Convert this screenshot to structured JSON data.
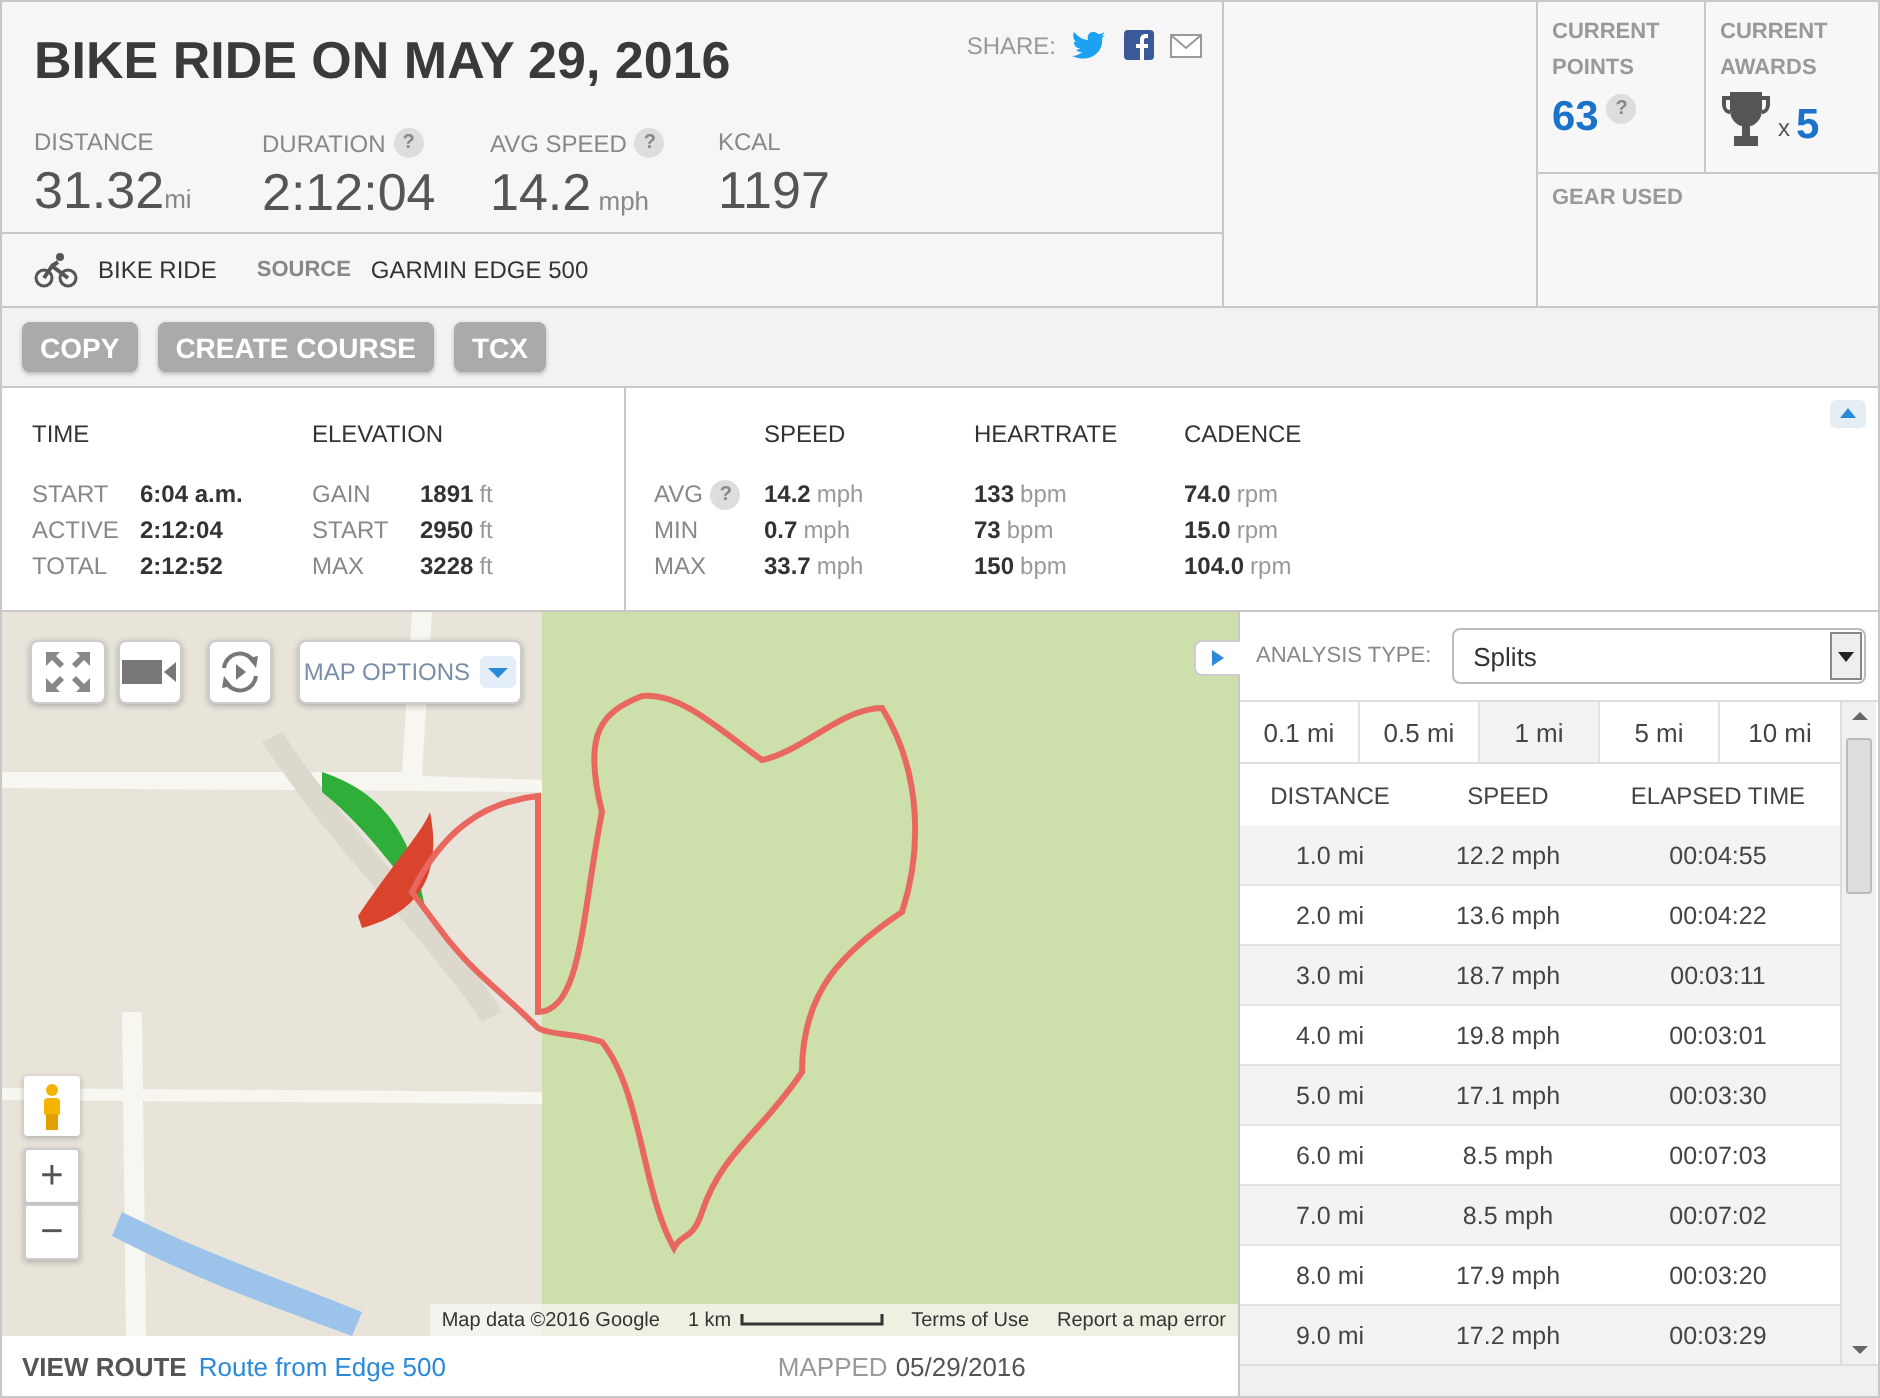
{
  "activity": {
    "title": "BIKE RIDE ON MAY 29, 2016",
    "share_label": "SHARE:",
    "stats": [
      {
        "label": "DISTANCE",
        "value": "31.32",
        "unit": "mi"
      },
      {
        "label": "DURATION",
        "help": "?",
        "value": "2:12:04"
      },
      {
        "label": "AVG SPEED",
        "help": "?",
        "value": "14.2",
        "unit": "mph"
      },
      {
        "label": "KCAL",
        "value": "1197"
      }
    ],
    "type": "BIKE RIDE",
    "source_label": "SOURCE",
    "source": "GARMIN EDGE 500"
  },
  "points": {
    "label": "CURRENT POINTS",
    "value": "63",
    "help": "?"
  },
  "awards": {
    "label": "CURRENT AWARDS",
    "multiplier": "x",
    "value": "5"
  },
  "gear": {
    "label": "GEAR USED"
  },
  "actions": [
    "COPY",
    "CREATE COURSE",
    "TCX"
  ],
  "summary": [
    {
      "title": "TIME",
      "rows": [
        {
          "label": "START",
          "value": "6:04 a.m."
        },
        {
          "label": "ACTIVE",
          "value": "2:12:04"
        },
        {
          "label": "TOTAL",
          "value": "2:12:52"
        }
      ]
    },
    {
      "title": "ELEVATION",
      "rows": [
        {
          "label": "GAIN",
          "value": "1891",
          "unit": "ft"
        },
        {
          "label": "START",
          "value": "2950",
          "unit": "ft"
        },
        {
          "label": "MAX",
          "value": "3228",
          "unit": "ft"
        }
      ]
    }
  ],
  "metrics": {
    "columns": [
      "SPEED",
      "HEARTRATE",
      "CADENCE"
    ],
    "rows": [
      {
        "label": "AVG",
        "help": "?",
        "cells": [
          {
            "value": "14.2",
            "unit": "mph"
          },
          {
            "value": "133",
            "unit": "bpm"
          },
          {
            "value": "74.0",
            "unit": "rpm"
          }
        ]
      },
      {
        "label": "MIN",
        "cells": [
          {
            "value": "0.7",
            "unit": "mph"
          },
          {
            "value": "73",
            "unit": "bpm"
          },
          {
            "value": "15.0",
            "unit": "rpm"
          }
        ]
      },
      {
        "label": "MAX",
        "cells": [
          {
            "value": "33.7",
            "unit": "mph"
          },
          {
            "value": "150",
            "unit": "bpm"
          },
          {
            "value": "104.0",
            "unit": "rpm"
          }
        ]
      }
    ]
  },
  "map": {
    "options": "MAP OPTIONS",
    "zoom_in": "+",
    "zoom_out": "−",
    "attribution": "Map data ©2016 Google",
    "scale": "1 km",
    "terms": "Terms of Use",
    "report": "Report a map error"
  },
  "route": {
    "label": "VIEW ROUTE",
    "link": "Route from Edge 500",
    "mapped_label": "MAPPED",
    "mapped_date": "05/29/2016"
  },
  "analysis": {
    "label": "ANALYSIS TYPE:",
    "value": "Splits",
    "intervals": [
      {
        "label": "0.1 mi",
        "selected": false
      },
      {
        "label": "0.5 mi",
        "selected": false
      },
      {
        "label": "1 mi",
        "selected": true
      },
      {
        "label": "5 mi",
        "selected": false
      },
      {
        "label": "10 mi",
        "selected": false
      }
    ],
    "columns": [
      "DISTANCE",
      "SPEED",
      "ELAPSED TIME"
    ],
    "rows": [
      [
        "1.0 mi",
        "12.2 mph",
        "00:04:55"
      ],
      [
        "2.0 mi",
        "13.6 mph",
        "00:04:22"
      ],
      [
        "3.0 mi",
        "18.7 mph",
        "00:03:11"
      ],
      [
        "4.0 mi",
        "19.8 mph",
        "00:03:01"
      ],
      [
        "5.0 mi",
        "17.1 mph",
        "00:03:30"
      ],
      [
        "6.0 mi",
        "8.5 mph",
        "00:07:03"
      ],
      [
        "7.0 mi",
        "8.5 mph",
        "00:07:02"
      ],
      [
        "8.0 mi",
        "17.9 mph",
        "00:03:20"
      ],
      [
        "9.0 mi",
        "17.2 mph",
        "00:03:29"
      ]
    ]
  }
}
